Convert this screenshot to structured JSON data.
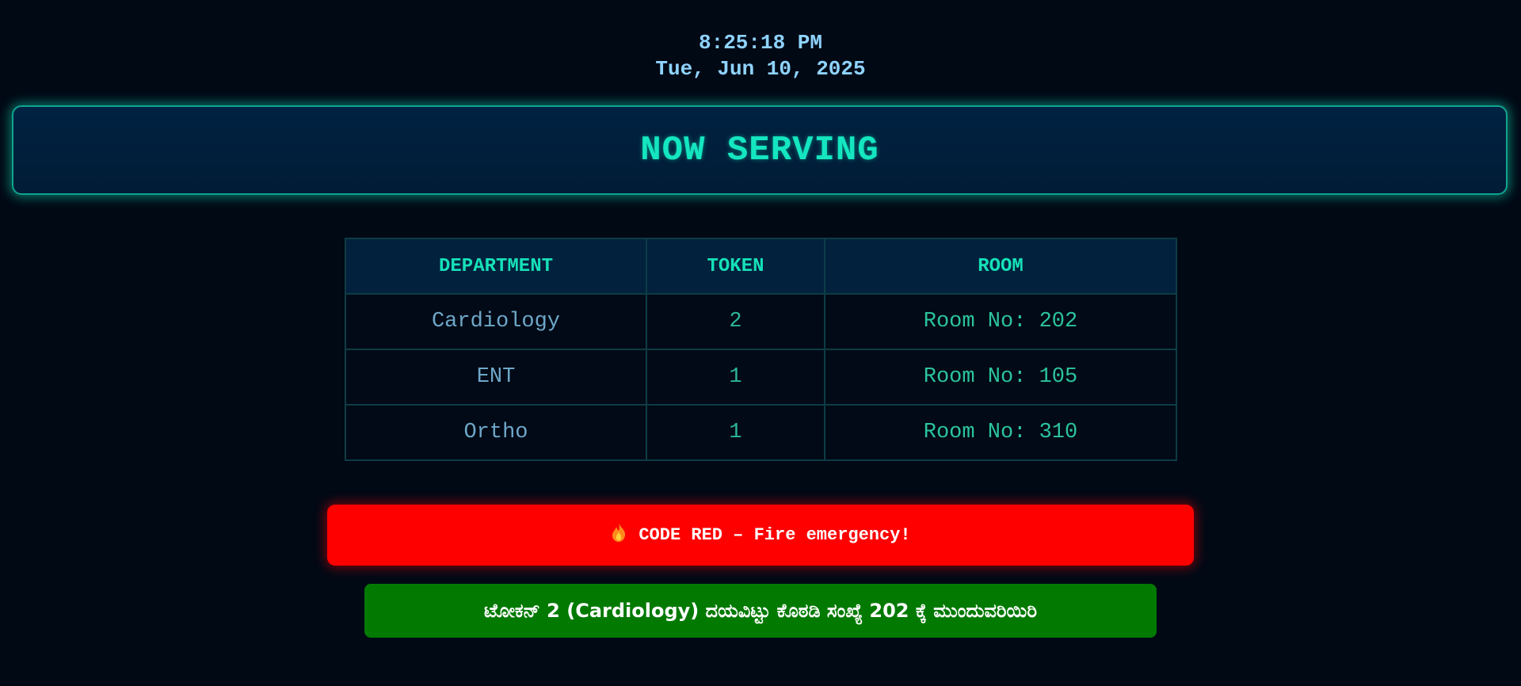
{
  "clock": {
    "time": "8:25:18 PM",
    "date": "Tue, Jun 10, 2025"
  },
  "banner": {
    "title": "NOW SERVING"
  },
  "table": {
    "headers": [
      "DEPARTMENT",
      "TOKEN",
      "ROOM"
    ],
    "rows": [
      {
        "department": "Cardiology",
        "token": "2",
        "room": "Room No: 202"
      },
      {
        "department": "ENT",
        "token": "1",
        "room": "Room No: 105"
      },
      {
        "department": "Ortho",
        "token": "1",
        "room": "Room No: 310"
      }
    ]
  },
  "alert": {
    "icon": "fire-icon",
    "text": "CODE RED – Fire emergency!",
    "color": "#ff0000"
  },
  "announcement": {
    "text": "ಟೋಕನ್ 2 (Cardiology) ದಯವಿಟ್ಟು ಕೊಠಡಿ ಸಂಖ್ಯೆ 202 ಕ್ಕೆ ಮುಂದುವರಿಯಿರಿ",
    "color": "#027a02"
  },
  "colors": {
    "background": "#010915",
    "accent": "#14e6c0",
    "clock": "#8fd3ff"
  }
}
